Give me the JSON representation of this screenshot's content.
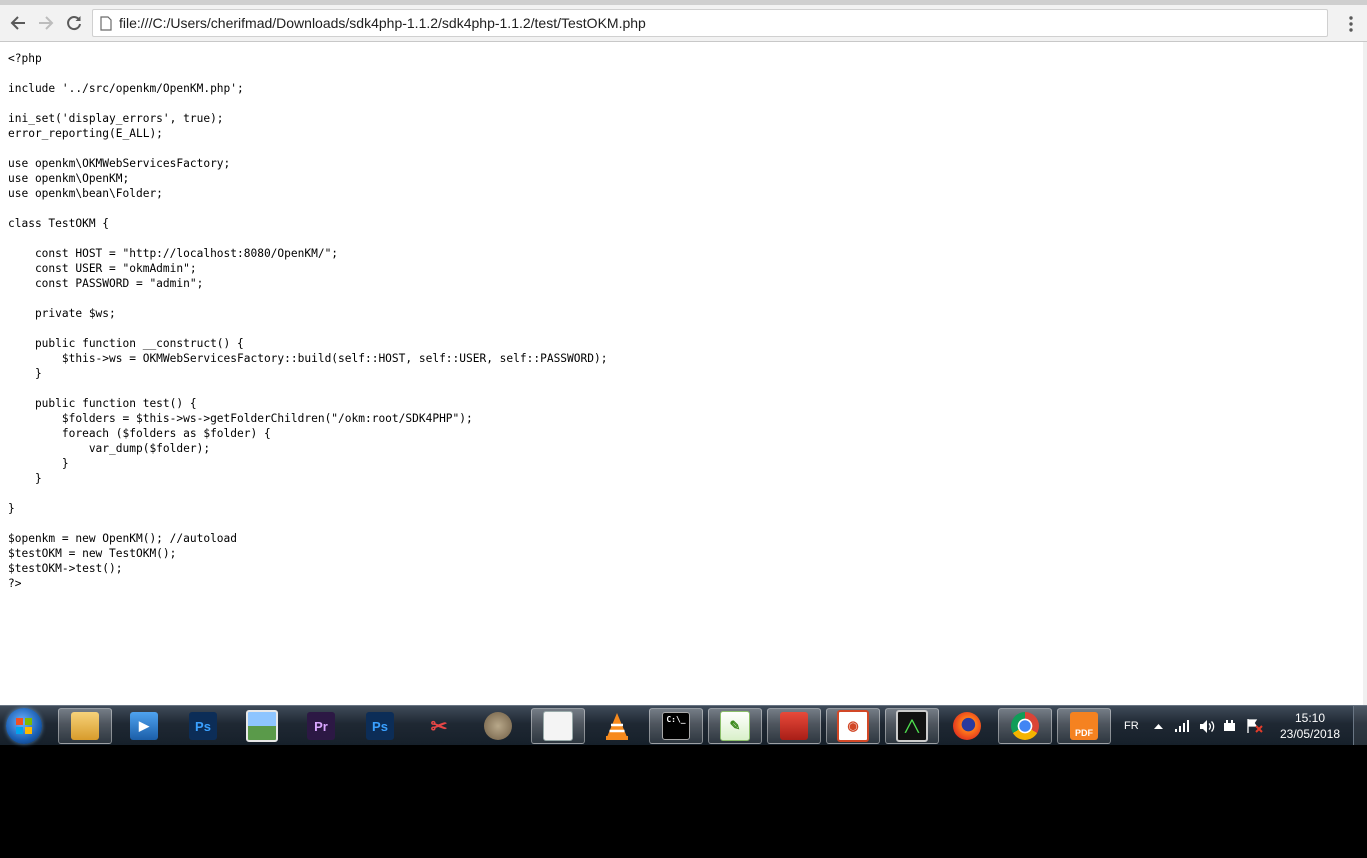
{
  "browser": {
    "url": "file:///C:/Users/cherifmad/Downloads/sdk4php-1.1.2/sdk4php-1.1.2/test/TestOKM.php",
    "back_icon": "arrow-left-icon",
    "forward_icon": "arrow-right-icon",
    "reload_icon": "reload-icon",
    "menu_icon": "kebab-menu-icon"
  },
  "document": {
    "source": "<?php\n\ninclude '../src/openkm/OpenKM.php';\n\nini_set('display_errors', true);\nerror_reporting(E_ALL);\n\nuse openkm\\OKMWebServicesFactory;\nuse openkm\\OpenKM;\nuse openkm\\bean\\Folder;\n\nclass TestOKM {\n\n    const HOST = \"http://localhost:8080/OpenKM/\";\n    const USER = \"okmAdmin\";\n    const PASSWORD = \"admin\";\n\n    private $ws;\n\n    public function __construct() {\n        $this->ws = OKMWebServicesFactory::build(self::HOST, self::USER, self::PASSWORD);\n    }\n\n    public function test() {\n        $folders = $this->ws->getFolderChildren(\"/okm:root/SDK4PHP\");\n        foreach ($folders as $folder) {\n            var_dump($folder);\n        }\n    }\n\n}\n\n$openkm = new OpenKM(); //autoload\n$testOKM = new TestOKM();\n$testOKM->test();\n?>"
  },
  "taskbar": {
    "language": "FR",
    "time": "15:10",
    "date": "23/05/2018",
    "apps": [
      {
        "name": "windows-explorer-icon",
        "label": ""
      },
      {
        "name": "media-player-icon",
        "label": ""
      },
      {
        "name": "photoshop-icon",
        "label": "Ps"
      },
      {
        "name": "photo-viewer-icon",
        "label": ""
      },
      {
        "name": "premiere-icon",
        "label": "Pr"
      },
      {
        "name": "photoshop-icon",
        "label": "Ps"
      },
      {
        "name": "snipping-tool-icon",
        "label": ""
      },
      {
        "name": "gimp-icon",
        "label": ""
      },
      {
        "name": "document-window-icon",
        "label": ""
      },
      {
        "name": "vlc-icon",
        "label": ""
      },
      {
        "name": "command-prompt-icon",
        "label": "C:\\_"
      },
      {
        "name": "notepad-plus-plus-icon",
        "label": ""
      },
      {
        "name": "toolbox-icon",
        "label": ""
      },
      {
        "name": "presentation-icon",
        "label": ""
      },
      {
        "name": "task-manager-icon",
        "label": ""
      },
      {
        "name": "firefox-icon",
        "label": ""
      },
      {
        "name": "chrome-icon",
        "label": ""
      },
      {
        "name": "pdf-app-icon",
        "label": "PDF"
      }
    ]
  }
}
